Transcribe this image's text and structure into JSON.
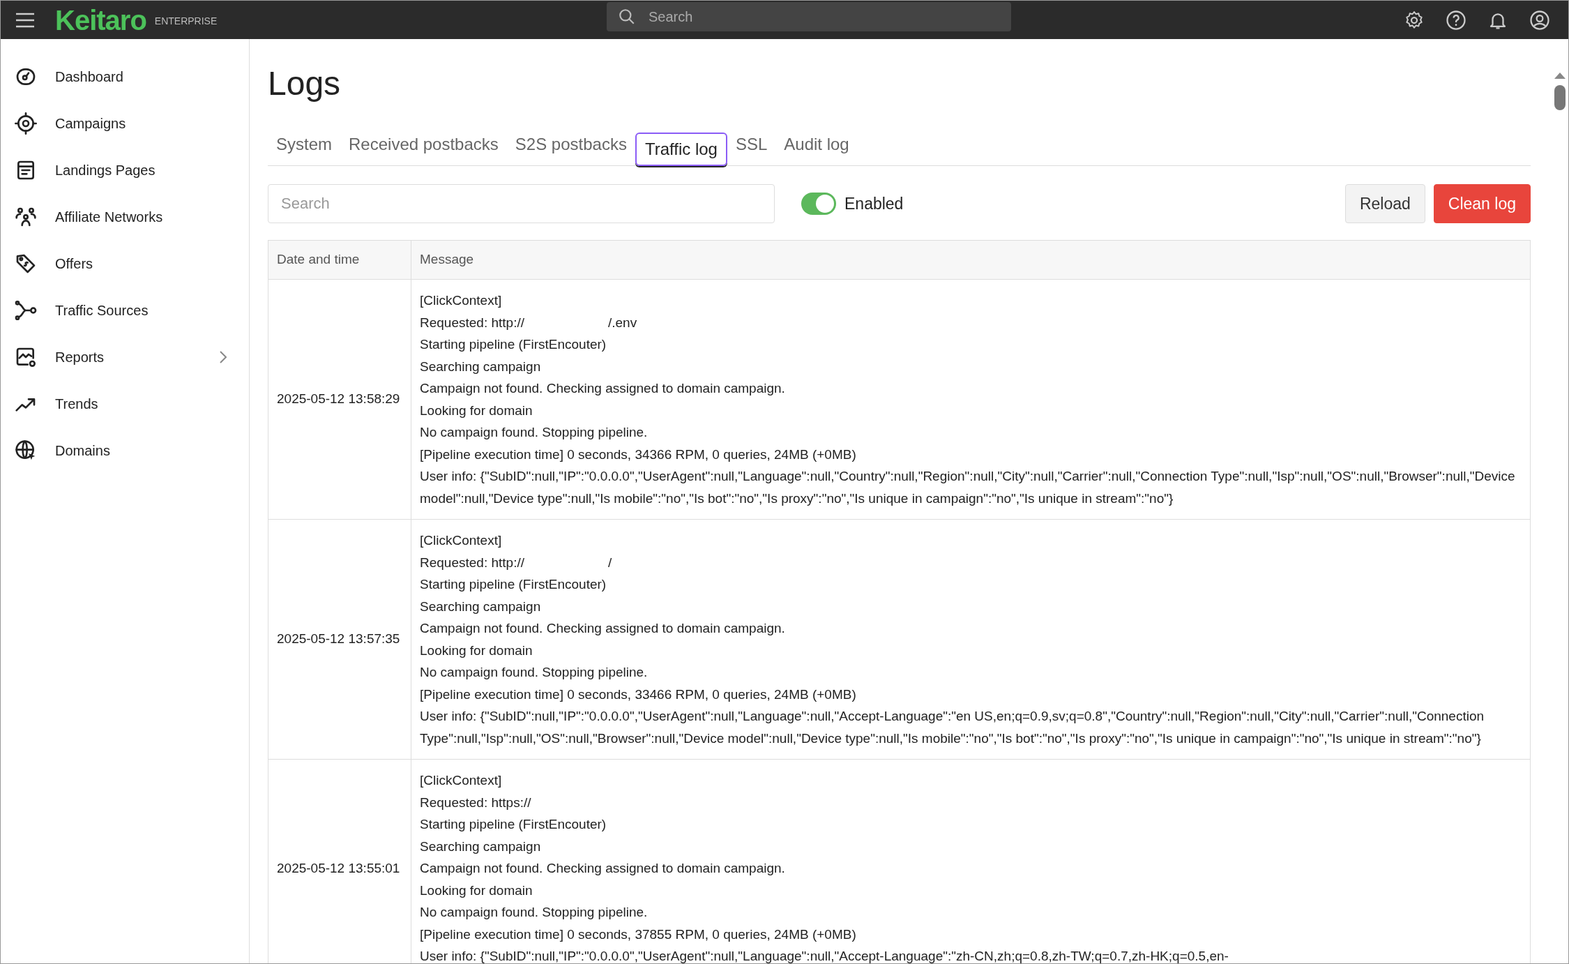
{
  "header": {
    "logo": "Keitaro",
    "edition": "ENTERPRISE",
    "search": {
      "placeholder": "Search"
    }
  },
  "sidebar": {
    "items": [
      {
        "label": "Dashboard",
        "has_submenu": false
      },
      {
        "label": "Campaigns",
        "has_submenu": false
      },
      {
        "label": "Landings Pages",
        "has_submenu": false
      },
      {
        "label": "Affiliate Networks",
        "has_submenu": false
      },
      {
        "label": "Offers",
        "has_submenu": false
      },
      {
        "label": "Traffic Sources",
        "has_submenu": false
      },
      {
        "label": "Reports",
        "has_submenu": true
      },
      {
        "label": "Trends",
        "has_submenu": false
      },
      {
        "label": "Domains",
        "has_submenu": false
      }
    ]
  },
  "page": {
    "title": "Logs",
    "tabs": [
      {
        "label": "System",
        "selected": false
      },
      {
        "label": "Received postbacks",
        "selected": false
      },
      {
        "label": "S2S postbacks",
        "selected": false
      },
      {
        "label": "Traffic log",
        "selected": true
      },
      {
        "label": "SSL",
        "selected": false
      },
      {
        "label": "Audit log",
        "selected": false
      }
    ],
    "search": {
      "placeholder": "Search"
    },
    "toggle": {
      "label": "Enabled",
      "on": true
    },
    "buttons": [
      {
        "label": "Reload",
        "kind": "default"
      },
      {
        "label": "Clean log",
        "kind": "danger"
      }
    ],
    "table": {
      "columns": [
        "Date and time",
        "Message"
      ],
      "rows": [
        {
          "date": "2025-05-12 13:58:29",
          "lines": [
            {
              "kind": "text",
              "text": "[ClickContext]"
            },
            {
              "kind": "redacted",
              "before": "Requested: http://",
              "after": "/.env"
            },
            {
              "kind": "text",
              "text": "Starting pipeline (FirstEncouter)"
            },
            {
              "kind": "text",
              "text": "Searching campaign"
            },
            {
              "kind": "text",
              "text": "Campaign not found. Checking assigned to domain campaign."
            },
            {
              "kind": "text",
              "text": "Looking for domain"
            },
            {
              "kind": "text",
              "text": "No campaign found. Stopping pipeline."
            },
            {
              "kind": "text",
              "text": "[Pipeline execution time] 0 seconds, 34366 RPM, 0 queries, 24MB (+0MB)"
            },
            {
              "kind": "text",
              "text": "User info: {\"SubID\":null,\"IP\":\"0.0.0.0\",\"UserAgent\":null,\"Language\":null,\"Country\":null,\"Region\":null,\"City\":null,\"Carrier\":null,\"Connection Type\":null,\"Isp\":null,\"OS\":null,\"Browser\":null,\"Device model\":null,\"Device type\":null,\"Is mobile\":\"no\",\"Is bot\":\"no\",\"Is proxy\":\"no\",\"Is unique in campaign\":\"no\",\"Is unique in stream\":\"no\"}"
            }
          ]
        },
        {
          "date": "2025-05-12 13:57:35",
          "lines": [
            {
              "kind": "text",
              "text": "[ClickContext]"
            },
            {
              "kind": "redacted",
              "before": "Requested: http://",
              "after": "/"
            },
            {
              "kind": "text",
              "text": "Starting pipeline (FirstEncouter)"
            },
            {
              "kind": "text",
              "text": "Searching campaign"
            },
            {
              "kind": "text",
              "text": "Campaign not found. Checking assigned to domain campaign."
            },
            {
              "kind": "text",
              "text": "Looking for domain"
            },
            {
              "kind": "text",
              "text": "No campaign found. Stopping pipeline."
            },
            {
              "kind": "text",
              "text": "[Pipeline execution time] 0 seconds, 33466 RPM, 0 queries, 24MB (+0MB)"
            },
            {
              "kind": "text",
              "text": "User info: {\"SubID\":null,\"IP\":\"0.0.0.0\",\"UserAgent\":null,\"Language\":null,\"Accept-Language\":\"en US,en;q=0.9,sv;q=0.8\",\"Country\":null,\"Region\":null,\"City\":null,\"Carrier\":null,\"Connection Type\":null,\"Isp\":null,\"OS\":null,\"Browser\":null,\"Device model\":null,\"Device type\":null,\"Is mobile\":\"no\",\"Is bot\":\"no\",\"Is proxy\":\"no\",\"Is unique in campaign\":\"no\",\"Is unique in stream\":\"no\"}"
            }
          ]
        },
        {
          "date": "2025-05-12 13:55:01",
          "lines": [
            {
              "kind": "text",
              "text": "[ClickContext]"
            },
            {
              "kind": "text",
              "text": "Requested: https://"
            },
            {
              "kind": "text",
              "text": "Starting pipeline (FirstEncouter)"
            },
            {
              "kind": "text",
              "text": "Searching campaign"
            },
            {
              "kind": "text",
              "text": "Campaign not found. Checking assigned to domain campaign."
            },
            {
              "kind": "text",
              "text": "Looking for domain"
            },
            {
              "kind": "text",
              "text": "No campaign found. Stopping pipeline."
            },
            {
              "kind": "text",
              "text": "[Pipeline execution time] 0 seconds, 37855 RPM, 0 queries, 24MB (+0MB)"
            },
            {
              "kind": "text",
              "text": "User info: {\"SubID\":null,\"IP\":\"0.0.0.0\",\"UserAgent\":null,\"Language\":null,\"Accept-Language\":\"zh-CN,zh;q=0.8,zh-TW;q=0.7,zh-HK;q=0.5,en-"
            }
          ]
        }
      ]
    }
  }
}
